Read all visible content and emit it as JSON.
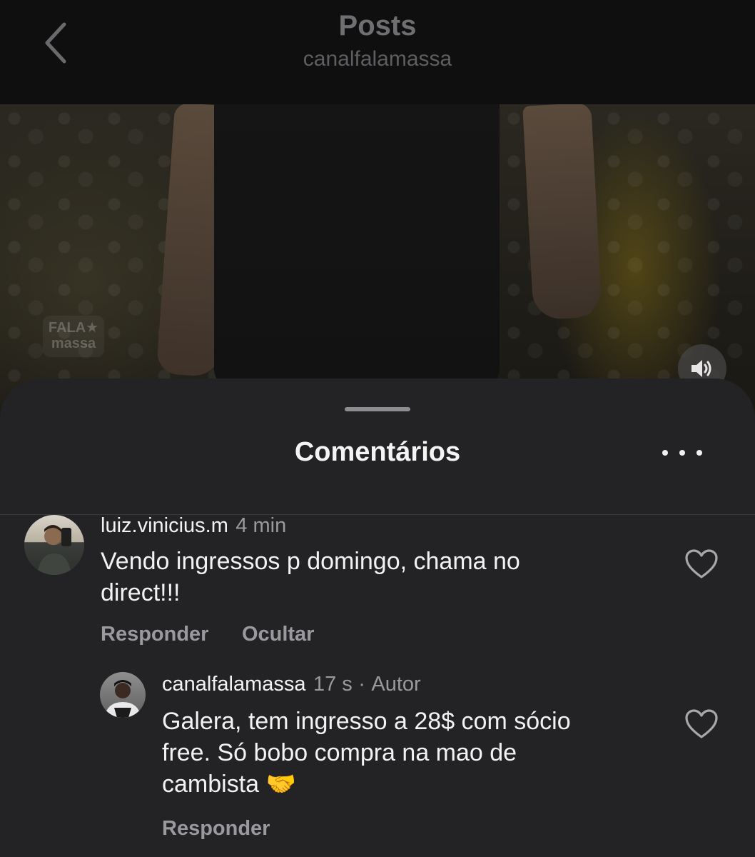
{
  "header": {
    "title": "Posts",
    "subtitle": "canalfalamassa"
  },
  "media": {
    "watermark_line1": "FALA★",
    "watermark_line2": "massa"
  },
  "sheet": {
    "title": "Comentários"
  },
  "comments": [
    {
      "username": "luiz.vinicius.m",
      "time": "4 min",
      "text_line1": "Vendo ingressos p domingo, chama no",
      "text_line2": "direct!!!",
      "actions": [
        "Responder",
        "Ocultar"
      ]
    }
  ],
  "reply": {
    "username": "canalfalamassa",
    "time": "17 s",
    "separator": "·",
    "badge": "Autor",
    "text_line1": "Galera, tem ingresso a 28$ com sócio",
    "text_line2": "free. Só bobo compra na mao de",
    "text_line3": "cambista",
    "emoji": "🤝",
    "action": "Responder"
  },
  "icons": {
    "back": "chevron-left-icon",
    "sound": "speaker-icon",
    "more": "ellipsis-icon",
    "like": "heart-icon"
  }
}
